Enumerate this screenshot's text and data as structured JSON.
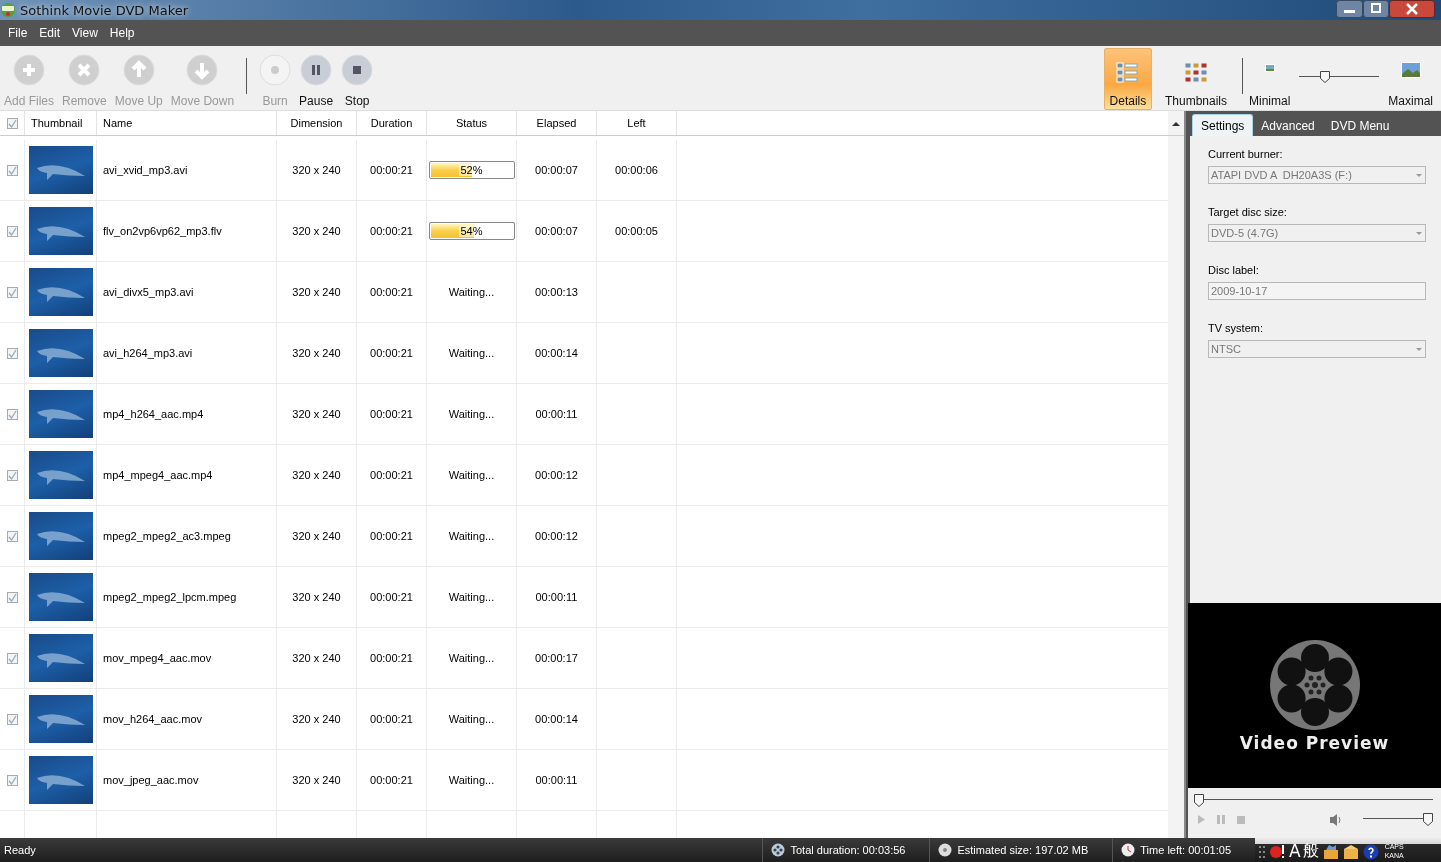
{
  "window": {
    "title": "Sothink Movie DVD Maker"
  },
  "menu": [
    "File",
    "Edit",
    "View",
    "Help"
  ],
  "toolbar": {
    "actions": [
      {
        "label": "Add Files",
        "kind": "add",
        "disabled": true
      },
      {
        "label": "Remove",
        "kind": "remove",
        "disabled": true
      },
      {
        "label": "Move Up",
        "kind": "up",
        "disabled": true
      },
      {
        "label": "Move Down",
        "kind": "down",
        "disabled": true
      },
      {
        "label": "Burn",
        "kind": "burn",
        "disabled": true
      },
      {
        "label": "Pause",
        "kind": "pause",
        "disabled": false
      },
      {
        "label": "Stop",
        "kind": "stop",
        "disabled": false
      }
    ],
    "views": [
      {
        "label": "Details",
        "kind": "details",
        "selected": true
      },
      {
        "label": "Thumbnails",
        "kind": "thumbnails",
        "selected": false
      }
    ],
    "size_slider": {
      "min_label": "Minimal",
      "max_label": "Maximal",
      "level": 0.3
    }
  },
  "table": {
    "header_checked": true,
    "columns": [
      "Thumbnail",
      "Name",
      "Dimension",
      "Duration",
      "Status",
      "Elapsed",
      "Left"
    ],
    "rows": [
      {
        "checked": true,
        "name": "avi_xvid_mp3.avi",
        "dimension": "320 x 240",
        "duration": "00:00:21",
        "status": {
          "kind": "progress",
          "level": 0.52,
          "text": "52%"
        },
        "elapsed": "00:00:07",
        "left": "00:00:06"
      },
      {
        "checked": true,
        "name": "flv_on2vp6vp62_mp3.flv",
        "dimension": "320 x 240",
        "duration": "00:00:21",
        "status": {
          "kind": "progress",
          "level": 0.54,
          "text": "54%"
        },
        "elapsed": "00:00:07",
        "left": "00:00:05"
      },
      {
        "checked": true,
        "name": "avi_divx5_mp3.avi",
        "dimension": "320 x 240",
        "duration": "00:00:21",
        "status": {
          "kind": "text",
          "text": "Waiting..."
        },
        "elapsed": "00:00:13"
      },
      {
        "checked": true,
        "name": "avi_h264_mp3.avi",
        "dimension": "320 x 240",
        "duration": "00:00:21",
        "status": {
          "kind": "text",
          "text": "Waiting..."
        },
        "elapsed": "00:00:14"
      },
      {
        "checked": true,
        "name": "mp4_h264_aac.mp4",
        "dimension": "320 x 240",
        "duration": "00:00:21",
        "status": {
          "kind": "text",
          "text": "Waiting..."
        },
        "elapsed": "00:00:11"
      },
      {
        "checked": true,
        "name": "mp4_mpeg4_aac.mp4",
        "dimension": "320 x 240",
        "duration": "00:00:21",
        "status": {
          "kind": "text",
          "text": "Waiting..."
        },
        "elapsed": "00:00:12"
      },
      {
        "checked": true,
        "name": "mpeg2_mpeg2_ac3.mpeg",
        "dimension": "320 x 240",
        "duration": "00:00:21",
        "status": {
          "kind": "text",
          "text": "Waiting..."
        },
        "elapsed": "00:00:12"
      },
      {
        "checked": true,
        "name": "mpeg2_mpeg2_lpcm.mpeg",
        "dimension": "320 x 240",
        "duration": "00:00:21",
        "status": {
          "kind": "text",
          "text": "Waiting..."
        },
        "elapsed": "00:00:11"
      },
      {
        "checked": true,
        "name": "mov_mpeg4_aac.mov",
        "dimension": "320 x 240",
        "duration": "00:00:21",
        "status": {
          "kind": "text",
          "text": "Waiting..."
        },
        "elapsed": "00:00:17"
      },
      {
        "checked": true,
        "name": "mov_h264_aac.mov",
        "dimension": "320 x 240",
        "duration": "00:00:21",
        "status": {
          "kind": "text",
          "text": "Waiting..."
        },
        "elapsed": "00:00:14"
      },
      {
        "checked": true,
        "name": "mov_jpeg_aac.mov",
        "dimension": "320 x 240",
        "duration": "00:00:21",
        "status": {
          "kind": "text",
          "text": "Waiting..."
        },
        "elapsed": "00:00:11"
      }
    ]
  },
  "side_panel": {
    "tabs": [
      {
        "label": "Settings",
        "selected": true
      },
      {
        "label": "Advanced",
        "selected": false
      },
      {
        "label": "DVD Menu",
        "selected": false
      }
    ],
    "fields": [
      {
        "kind": "select",
        "label": "Current burner:",
        "value": "ATAPI DVD A  DH20A3S (F:)"
      },
      {
        "kind": "select",
        "label": "Target disc size:",
        "value": "DVD-5 (4.7G)"
      },
      {
        "kind": "text",
        "label": "Disc label:",
        "value": "2009-10-17"
      },
      {
        "kind": "select",
        "label": "TV system:",
        "value": "NTSC"
      }
    ],
    "preview": {
      "caption": "Video Preview"
    },
    "player": {
      "seek": {
        "level": 0
      },
      "volume": {
        "level": 1
      }
    }
  },
  "status_bar": {
    "status": "Ready",
    "items": [
      {
        "kind": "duration",
        "text": "Total duration: 00:03:56"
      },
      {
        "kind": "size",
        "text": "Estimated size: 197.02 MB"
      },
      {
        "kind": "time",
        "text": "Time left: 00:01:05"
      }
    ]
  },
  "ime_bar": {
    "mode": "A",
    "input": "般",
    "caps": "CAPS",
    "kana": "KANA"
  }
}
